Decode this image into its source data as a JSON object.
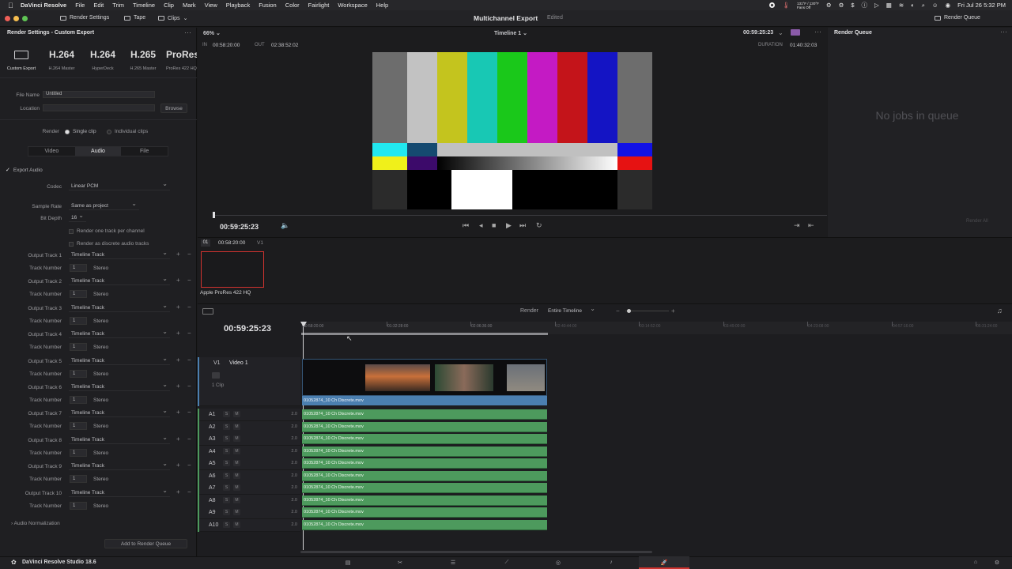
{
  "menubar": {
    "items": [
      "DaVinci Resolve",
      "File",
      "Edit",
      "Trim",
      "Timeline",
      "Clip",
      "Mark",
      "View",
      "Playback",
      "Fusion",
      "Color",
      "Fairlight",
      "Workspace",
      "Help"
    ],
    "temp": "131°F / 130°F",
    "fans": "Fans Off",
    "datetime": "Fri Jul 26  5:32 PM"
  },
  "toolbar": {
    "render_settings": "Render Settings",
    "tape": "Tape",
    "clips": "Clips",
    "project_title": "Multichannel Export",
    "edited": "Edited",
    "render_queue": "Render Queue"
  },
  "left": {
    "title": "Render Settings - Custom Export",
    "presets": [
      {
        "big": "",
        "cap": "Custom Export"
      },
      {
        "big": "H.264",
        "cap": "H.264 Master"
      },
      {
        "big": "H.264",
        "cap": "HyperDeck"
      },
      {
        "big": "H.265",
        "cap": "H.265 Master"
      },
      {
        "big": "ProRes",
        "cap": "ProRes 422 HQ"
      }
    ],
    "file_name_label": "File Name",
    "file_name_value": "Untitled",
    "location_label": "Location",
    "browse": "Browse",
    "render_label": "Render",
    "single_clip": "Single clip",
    "individual_clips": "Individual clips",
    "tabs": [
      "Video",
      "Audio",
      "File"
    ],
    "export_audio": "Export Audio",
    "codec_label": "Codec",
    "codec_value": "Linear PCM",
    "sample_rate_label": "Sample Rate",
    "sample_rate_value": "Same as project",
    "bit_depth_label": "Bit Depth",
    "bit_depth_value": "16",
    "render_one_track": "Render one track per channel",
    "render_discrete": "Render as discrete audio tracks",
    "output_tracks": [
      {
        "label": "Output Track 1",
        "value": "Timeline Track",
        "num_label": "Track Number",
        "num": "1",
        "ch": "Stereo"
      },
      {
        "label": "Output Track 2",
        "value": "Timeline Track",
        "num_label": "Track Number",
        "num": "1",
        "ch": "Stereo"
      },
      {
        "label": "Output Track 3",
        "value": "Timeline Track",
        "num_label": "Track Number",
        "num": "1",
        "ch": "Stereo"
      },
      {
        "label": "Output Track 4",
        "value": "Timeline Track",
        "num_label": "Track Number",
        "num": "1",
        "ch": "Stereo"
      },
      {
        "label": "Output Track 5",
        "value": "Timeline Track",
        "num_label": "Track Number",
        "num": "1",
        "ch": "Stereo"
      },
      {
        "label": "Output Track 6",
        "value": "Timeline Track",
        "num_label": "Track Number",
        "num": "1",
        "ch": "Stereo"
      },
      {
        "label": "Output Track 7",
        "value": "Timeline Track",
        "num_label": "Track Number",
        "num": "1",
        "ch": "Stereo"
      },
      {
        "label": "Output Track 8",
        "value": "Timeline Track",
        "num_label": "Track Number",
        "num": "1",
        "ch": "Stereo"
      },
      {
        "label": "Output Track 9",
        "value": "Timeline Track",
        "num_label": "Track Number",
        "num": "1",
        "ch": "Stereo"
      },
      {
        "label": "Output Track 10",
        "value": "Timeline Track",
        "num_label": "Track Number",
        "num": "1",
        "ch": "Stereo"
      }
    ],
    "audio_normalization": "Audio Normalization",
    "add_to_queue": "Add to Render Queue"
  },
  "viewer": {
    "zoom": "66%",
    "timeline_name": "Timeline 1",
    "timecode_top": "00:59:25:23",
    "in_label": "IN",
    "in_tc": "00:58:20:00",
    "out_label": "OUT",
    "out_tc": "02:38:52:02",
    "duration_label": "DURATION",
    "duration_tc": "01:40:32:03",
    "current_tc": "00:59:25:23",
    "playhead_fraction": 0.0
  },
  "render_queue": {
    "title": "Render Queue",
    "empty": "No jobs in queue",
    "render_all": "Render All"
  },
  "clips": {
    "index": "01",
    "tc": "00:58:20:00",
    "track": "V1",
    "name": "Apple ProRes 422 HQ"
  },
  "timeline": {
    "render_label": "Render",
    "render_value": "Entire Timeline",
    "timecode": "00:59:25:23",
    "ticks": [
      "00:58:20:00",
      "01:32:28:00",
      "02:06:36:00",
      "02:40:44:00",
      "03:14:52:00",
      "03:49:00:00",
      "04:23:08:00",
      "04:57:16:00",
      "05:31:24:00"
    ],
    "v1_label": "V1",
    "v1_name": "Video 1",
    "v1_clips": "1 Clip",
    "video_clip_name": "01052874_10 Ch Discrete.mov",
    "audio_tracks": [
      {
        "name": "A1",
        "vol": "2.0",
        "clip": "01052874_10 Ch Discrete.mov"
      },
      {
        "name": "A2",
        "vol": "2.0",
        "clip": "01052874_10 Ch Discrete.mov"
      },
      {
        "name": "A3",
        "vol": "2.0",
        "clip": "01052874_10 Ch Discrete.mov"
      },
      {
        "name": "A4",
        "vol": "2.0",
        "clip": "01052874_10 Ch Discrete.mov"
      },
      {
        "name": "A5",
        "vol": "2.0",
        "clip": "01052874_10 Ch Discrete.mov"
      },
      {
        "name": "A6",
        "vol": "2.0",
        "clip": "01052874_10 Ch Discrete.mov"
      },
      {
        "name": "A7",
        "vol": "2.0",
        "clip": "01052874_10 Ch Discrete.mov"
      },
      {
        "name": "A8",
        "vol": "2.0",
        "clip": "01052874_10 Ch Discrete.mov"
      },
      {
        "name": "A9",
        "vol": "2.0",
        "clip": "01052874_10 Ch Discrete.mov"
      },
      {
        "name": "A10",
        "vol": "2.0",
        "clip": "01052874_10 Ch Discrete.mov"
      }
    ],
    "solo": "S",
    "mute": "M"
  },
  "footer": {
    "app_name": "DaVinci Resolve Studio 18.6"
  },
  "colors": {
    "accent_red": "#d0332f",
    "audio_green": "#4d9a5d",
    "video_blue": "#4b7fb0"
  }
}
